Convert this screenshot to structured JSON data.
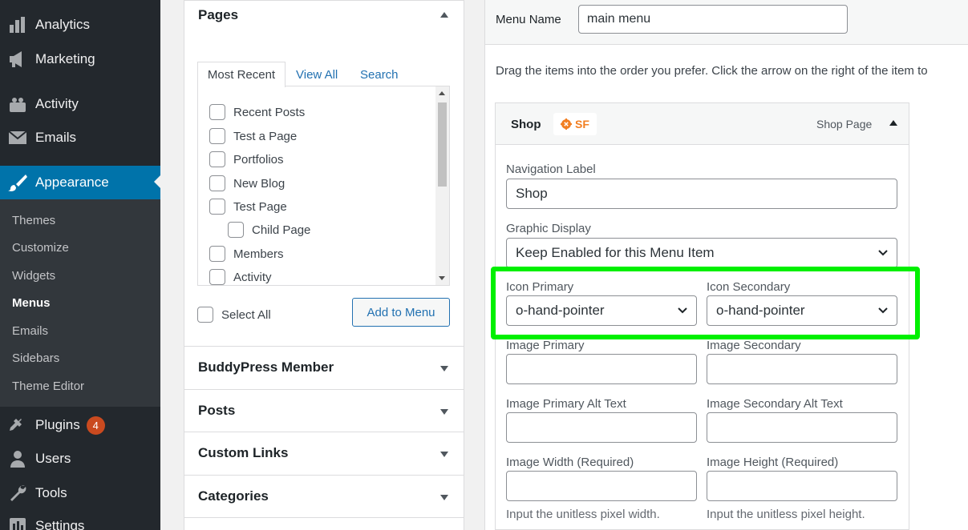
{
  "admin_menu": {
    "items": [
      {
        "label": "Analytics",
        "icon": "chart-bar-icon"
      },
      {
        "label": "Marketing",
        "icon": "megaphone-icon"
      },
      {
        "label": "Activity",
        "icon": "activity-icon"
      },
      {
        "label": "Emails",
        "icon": "envelope-icon"
      },
      {
        "label": "Appearance",
        "icon": "paintbrush-icon"
      },
      {
        "label": "Plugins",
        "icon": "plug-icon",
        "badge": "4"
      },
      {
        "label": "Users",
        "icon": "user-icon"
      },
      {
        "label": "Tools",
        "icon": "wrench-icon"
      },
      {
        "label": "Settings",
        "icon": "settings-icon"
      }
    ],
    "submenu": [
      "Themes",
      "Customize",
      "Widgets",
      "Menus",
      "Emails",
      "Sidebars",
      "Theme Editor"
    ],
    "accent": "#0073aa"
  },
  "pages_box": {
    "title": "Pages",
    "tabs": [
      "Most Recent",
      "View All",
      "Search"
    ],
    "items": [
      "Recent Posts",
      "Test a Page",
      "Portfolios",
      "New Blog",
      "Test Page",
      "Child Page",
      "Members",
      "Activity"
    ],
    "select_all": "Select All",
    "add_button": "Add to Menu"
  },
  "sections": [
    "BuddyPress Member",
    "Posts",
    "Custom Links",
    "Categories"
  ],
  "menu": {
    "name_label": "Menu Name",
    "name_value": "main menu",
    "help": "Drag the items into the order you prefer. Click the arrow on the right of the item to"
  },
  "menu_item": {
    "title": "Shop",
    "badge": "SF",
    "type": "Shop Page",
    "nav_label_label": "Navigation Label",
    "nav_label_value": "Shop",
    "graphic_label": "Graphic Display",
    "graphic_value": "Keep Enabled for this Menu Item",
    "icon_primary_label": "Icon Primary",
    "icon_primary_value": "o-hand-pointer",
    "icon_secondary_label": "Icon Secondary",
    "icon_secondary_value": "o-hand-pointer",
    "image_primary_label": "Image Primary",
    "image_secondary_label": "Image Secondary",
    "image_primary_alt_label": "Image Primary Alt Text",
    "image_secondary_alt_label": "Image Secondary Alt Text",
    "image_width_label": "Image Width (Required)",
    "image_height_label": "Image Height (Required)",
    "width_hint": "Input the unitless pixel width.",
    "height_hint": "Input the unitless pixel height."
  },
  "highlight_color": "#00f000"
}
